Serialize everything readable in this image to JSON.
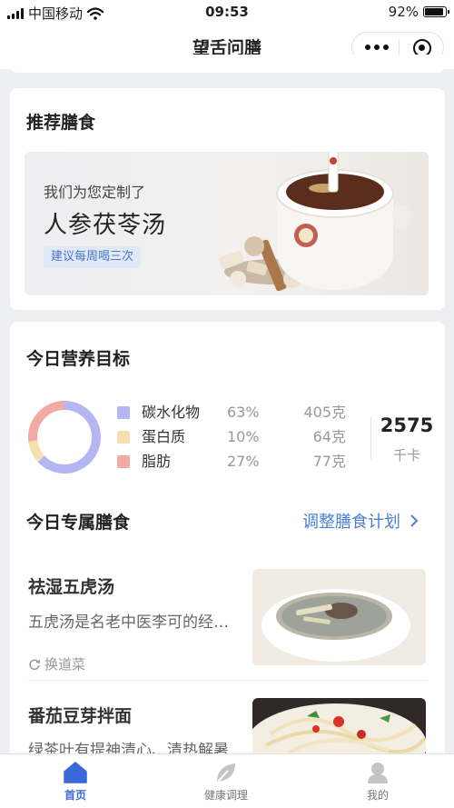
{
  "status_bar": {
    "carrier": "中国移动",
    "time": "09:53",
    "battery_percent": "92%",
    "battery_level": 0.92,
    "wifi_icon": "wifi-icon"
  },
  "nav": {
    "title": "望舌问膳"
  },
  "recommend": {
    "heading": "推荐膳食",
    "banner_subtitle": "我们为您定制了",
    "banner_title": "人参茯苓汤",
    "banner_tag": "建议每周喝三次"
  },
  "nutrition": {
    "heading": "今日营养目标",
    "items": [
      {
        "name": "碳水化物",
        "percent": "63%",
        "amount": "405克",
        "color": "#b3b6f2",
        "ratio": 0.63
      },
      {
        "name": "蛋白质",
        "percent": "10%",
        "amount": "64克",
        "color": "#f7dfae",
        "ratio": 0.1
      },
      {
        "name": "脂肪",
        "percent": "27%",
        "amount": "77克",
        "color": "#f2aaa6",
        "ratio": 0.27
      }
    ],
    "calories": "2575",
    "calories_unit": "千卡"
  },
  "meals": {
    "heading": "今日专属膳食",
    "adjust_link": "调整膳食计划",
    "swap_label": "换道菜",
    "dishes": [
      {
        "title": "祛湿五虎汤",
        "desc": "五虎汤是名老中医李可的经验方"
      },
      {
        "title": "番茄豆芽拌面",
        "desc": "绿茶叶有提神清心、清热解暑"
      }
    ]
  },
  "tabbar": {
    "items": [
      {
        "label": "首页",
        "icon": "home-icon",
        "active": true
      },
      {
        "label": "健康调理",
        "icon": "leaf-icon",
        "active": false
      },
      {
        "label": "我的",
        "icon": "user-icon",
        "active": false
      }
    ],
    "active_color": "#3b68d8"
  }
}
